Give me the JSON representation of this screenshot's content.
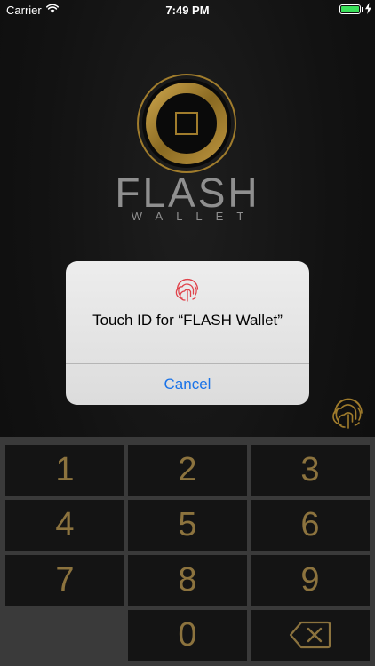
{
  "status_bar": {
    "carrier": "Carrier",
    "time": "7:49 PM",
    "battery_color": "#3be05a"
  },
  "logo": {
    "name": "FLASH",
    "subtitle": "WALLET",
    "ring_color": "#a07c2c"
  },
  "alert": {
    "icon": "fingerprint-icon",
    "title": "Touch ID for “FLASH Wallet”",
    "cancel_label": "Cancel",
    "icon_color": "#e0424a",
    "cancel_color": "#1a73e8"
  },
  "fingerprint_button": {
    "icon": "fingerprint-icon",
    "color": "#a07c2c"
  },
  "keypad": {
    "key_color": "#8c733e",
    "keys": [
      {
        "label": "1"
      },
      {
        "label": "2"
      },
      {
        "label": "3"
      },
      {
        "label": "4"
      },
      {
        "label": "5"
      },
      {
        "label": "6"
      },
      {
        "label": "7"
      },
      {
        "label": "8"
      },
      {
        "label": "9"
      },
      {
        "label": ""
      },
      {
        "label": "0"
      },
      {
        "icon": "backspace-icon"
      }
    ]
  }
}
